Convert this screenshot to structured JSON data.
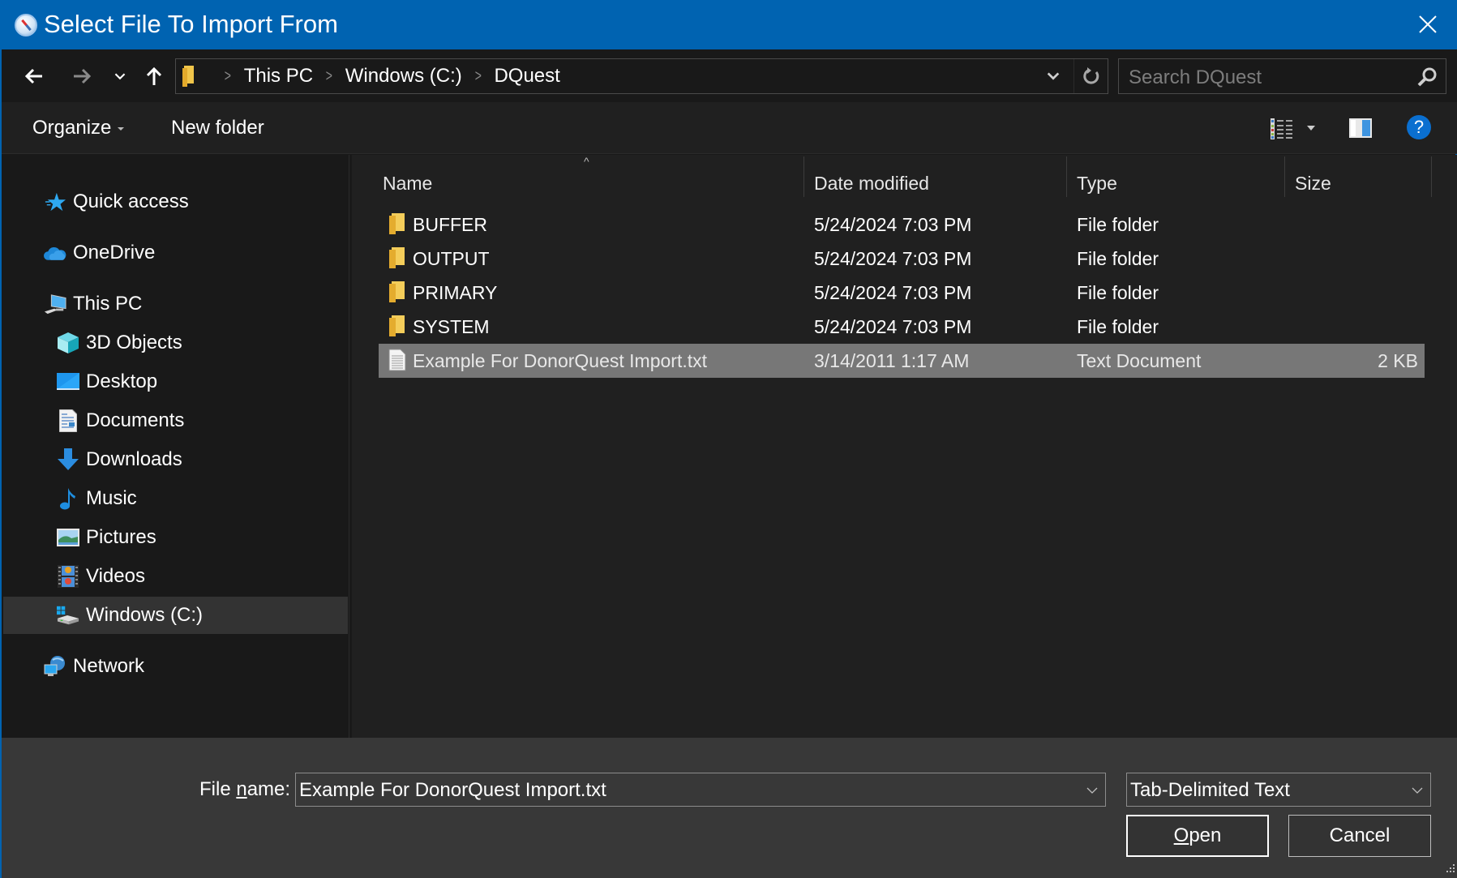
{
  "window": {
    "title": "Select File To Import From",
    "app_icon": "compass-icon",
    "close_icon": "close-icon"
  },
  "navigation": {
    "back_icon": "arrow-left-icon",
    "forward_icon": "arrow-right-icon",
    "recent_icon": "chevron-down-icon",
    "up_icon": "arrow-up-icon"
  },
  "address_bar": {
    "breadcrumbs": [
      "This PC",
      "Windows (C:)",
      "DQuest"
    ],
    "refresh_icon": "refresh-icon"
  },
  "search": {
    "placeholder": "Search DQuest"
  },
  "command_bar": {
    "organize_label": "Organize",
    "new_folder_label": "New folder",
    "view_icon": "details-view-icon",
    "preview_pane_icon": "preview-pane-icon",
    "help_label": "?"
  },
  "sidebar": {
    "items": [
      {
        "label": "Quick access",
        "icon": "star-icon",
        "level": 0
      },
      {
        "label": "OneDrive",
        "icon": "cloud-icon",
        "level": 0
      },
      {
        "label": "This PC",
        "icon": "computer-icon",
        "level": 0
      },
      {
        "label": "3D Objects",
        "icon": "cube-icon",
        "level": 1
      },
      {
        "label": "Desktop",
        "icon": "desktop-icon",
        "level": 1
      },
      {
        "label": "Documents",
        "icon": "document-icon",
        "level": 1
      },
      {
        "label": "Downloads",
        "icon": "download-arrow-icon",
        "level": 1
      },
      {
        "label": "Music",
        "icon": "music-note-icon",
        "level": 1
      },
      {
        "label": "Pictures",
        "icon": "picture-icon",
        "level": 1
      },
      {
        "label": "Videos",
        "icon": "film-icon",
        "level": 1
      },
      {
        "label": "Windows (C:)",
        "icon": "drive-icon",
        "level": 1,
        "selected": true
      },
      {
        "label": "Network",
        "icon": "network-icon",
        "level": 0
      }
    ]
  },
  "file_list": {
    "columns": [
      "Name",
      "Date modified",
      "Type",
      "Size"
    ],
    "sorted_by": "Name",
    "rows": [
      {
        "name": "BUFFER",
        "date": "5/24/2024 7:03 PM",
        "type": "File folder",
        "size": "",
        "icon": "folder-icon"
      },
      {
        "name": "OUTPUT",
        "date": "5/24/2024 7:03 PM",
        "type": "File folder",
        "size": "",
        "icon": "folder-icon"
      },
      {
        "name": "PRIMARY",
        "date": "5/24/2024 7:03 PM",
        "type": "File folder",
        "size": "",
        "icon": "folder-icon"
      },
      {
        "name": "SYSTEM",
        "date": "5/24/2024 7:03 PM",
        "type": "File folder",
        "size": "",
        "icon": "folder-icon"
      },
      {
        "name": "Example For DonorQuest Import.txt",
        "date": "3/14/2011 1:17 AM",
        "type": "Text Document",
        "size": "2 KB",
        "icon": "text-file-icon",
        "selected": true
      }
    ]
  },
  "footer": {
    "file_name_label_pre": "File ",
    "file_name_label_underlined": "n",
    "file_name_label_post": "ame:",
    "file_name_value": "Example For DonorQuest Import.txt",
    "file_type_value": "Tab-Delimited Text",
    "open_label_underlined": "O",
    "open_label_rest": "pen",
    "cancel_label": "Cancel"
  },
  "colors": {
    "title_bar": "#0063b1",
    "selection": "#777777",
    "sidebar_selection": "#333333",
    "accent_blue": "#0a6fd0"
  }
}
